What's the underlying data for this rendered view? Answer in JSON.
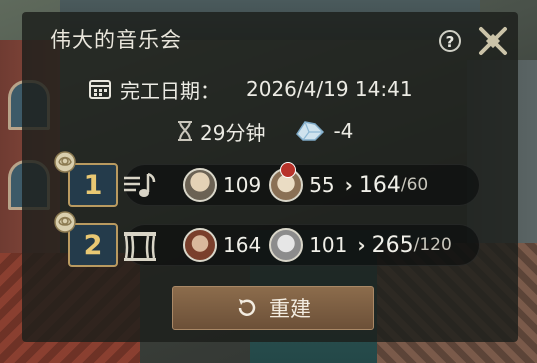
{
  "dialog": {
    "title": "伟大的音乐会",
    "help_label": "?",
    "completion_label": "完工日期：",
    "completion_value": "2026/4/19 14:41",
    "duration": "29分钟",
    "cost": "-4",
    "slots": [
      {
        "rank": "1",
        "type_icon": "music-note-icon",
        "score_a": "109",
        "score_b": "55",
        "total": "164",
        "requirement": "/60"
      },
      {
        "rank": "2",
        "type_icon": "stage-icon",
        "score_a": "164",
        "score_b": "101",
        "total": "265",
        "requirement": "/120"
      }
    ],
    "rebuild_label": "重建"
  },
  "colors": {
    "panel_bg": "#1c1e1b",
    "rank_text": "#e9c873",
    "rank_border": "#b99a60",
    "button": "#7c5e42"
  }
}
